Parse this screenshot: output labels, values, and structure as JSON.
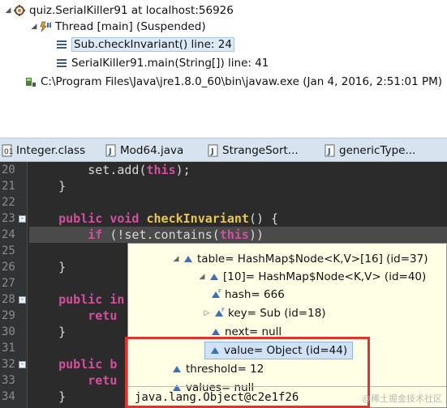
{
  "debug": {
    "target_label": "quiz.SerialKiller91 at localhost:56926",
    "thread_label": "Thread [main] (Suspended)",
    "frames": [
      {
        "label": "Sub.checkInvariant() line: 24"
      },
      {
        "label": "SerialKiller91.main(String[]) line: 41"
      }
    ],
    "process_label": "C:\\Program Files\\Java\\jre1.8.0_60\\bin\\javaw.exe (Jan 4, 2016, 2:51:01 PM)"
  },
  "tabs": [
    {
      "label": "Integer.class",
      "icon": "class-file-icon"
    },
    {
      "label": "Mod64.java",
      "icon": "java-file-icon"
    },
    {
      "label": "StrangeSort...",
      "icon": "java-file-icon"
    },
    {
      "label": "genericType...",
      "icon": "java-file-icon"
    }
  ],
  "editor": {
    "current_line": "24",
    "lines": [
      {
        "n": "20",
        "tokens": [
          {
            "t": "        ",
            "c": "id"
          },
          {
            "t": "set",
            "c": "id"
          },
          {
            "t": ".",
            "c": "id"
          },
          {
            "t": "add",
            "c": "id"
          },
          {
            "t": "(",
            "c": "id"
          },
          {
            "t": "this",
            "c": "kw"
          },
          {
            "t": ");",
            "c": "id"
          }
        ]
      },
      {
        "n": "21",
        "tokens": [
          {
            "t": "    }",
            "c": "id"
          }
        ]
      },
      {
        "n": "22",
        "tokens": []
      },
      {
        "n": "23",
        "fold": "-",
        "tokens": [
          {
            "t": "    ",
            "c": "id"
          },
          {
            "t": "public",
            "c": "kw"
          },
          {
            "t": " ",
            "c": "id"
          },
          {
            "t": "void",
            "c": "kw"
          },
          {
            "t": " ",
            "c": "id"
          },
          {
            "t": "checkInvariant",
            "c": "fn"
          },
          {
            "t": "() {",
            "c": "id"
          }
        ]
      },
      {
        "n": "24",
        "tokens": [
          {
            "t": "        ",
            "c": "id"
          },
          {
            "t": "if",
            "c": "kw"
          },
          {
            "t": " (!",
            "c": "id"
          },
          {
            "t": "set",
            "c": "id"
          },
          {
            "t": ".",
            "c": "id"
          },
          {
            "t": "contains",
            "c": "id"
          },
          {
            "t": "(",
            "c": "id"
          },
          {
            "t": "this",
            "c": "kw"
          },
          {
            "t": "))",
            "c": "id"
          }
        ]
      },
      {
        "n": "25",
        "tokens": []
      },
      {
        "n": "26",
        "tokens": [
          {
            "t": "    }",
            "c": "id"
          }
        ]
      },
      {
        "n": "27",
        "tokens": []
      },
      {
        "n": "28",
        "fold": "-",
        "tokens": [
          {
            "t": "    ",
            "c": "id"
          },
          {
            "t": "public",
            "c": "kw"
          },
          {
            "t": " ",
            "c": "id"
          },
          {
            "t": "in",
            "c": "kw"
          }
        ]
      },
      {
        "n": "29",
        "tokens": [
          {
            "t": "        ",
            "c": "id"
          },
          {
            "t": "retu",
            "c": "kw"
          }
        ]
      },
      {
        "n": "30",
        "tokens": [
          {
            "t": "    }",
            "c": "id"
          }
        ]
      },
      {
        "n": "31",
        "tokens": []
      },
      {
        "n": "32",
        "fold": "-",
        "tokens": [
          {
            "t": "    ",
            "c": "id"
          },
          {
            "t": "public",
            "c": "kw"
          },
          {
            "t": " ",
            "c": "id"
          },
          {
            "t": "b",
            "c": "kw"
          }
        ]
      },
      {
        "n": "33",
        "tokens": [
          {
            "t": "        ",
            "c": "id"
          },
          {
            "t": "retu",
            "c": "kw"
          }
        ]
      },
      {
        "n": "34",
        "tokens": [
          {
            "t": "    }",
            "c": "id"
          }
        ]
      }
    ]
  },
  "popup": {
    "rows": [
      {
        "label": "table= HashMap$Node<K,V>[16]  (id=37)",
        "twisty": "down",
        "icon": "field-icon",
        "final": false
      },
      {
        "label": "[10]= HashMap$Node<K,V>  (id=40)",
        "twisty": "down",
        "icon": "field-icon",
        "final": false
      },
      {
        "label": "hash= 666",
        "twisty": "",
        "icon": "final-field-icon",
        "final": true
      },
      {
        "label": "key= Sub  (id=18)",
        "twisty": "right",
        "icon": "final-field-icon",
        "final": true
      },
      {
        "label": "next= null",
        "twisty": "",
        "icon": "field-icon",
        "final": false
      },
      {
        "label": "value= Object  (id=44)",
        "twisty": "",
        "icon": "field-icon",
        "final": false,
        "selected": true
      },
      {
        "label": "threshold= 12",
        "twisty": "",
        "icon": "field-icon",
        "final": false
      },
      {
        "label": "values= null",
        "twisty": "",
        "icon": "field-icon",
        "final": false
      }
    ],
    "detail_text": "java.lang.Object@c2e1f26"
  },
  "watermark": "@稀土掘金技术社区",
  "colors": {
    "editor_bg": "#2b2b2b",
    "keyword": "#d34f9e",
    "method": "#e9c94d",
    "popup_bg": "#ffffe6",
    "annotation_red": "#e0332f",
    "selection": "#cfe2f7"
  }
}
